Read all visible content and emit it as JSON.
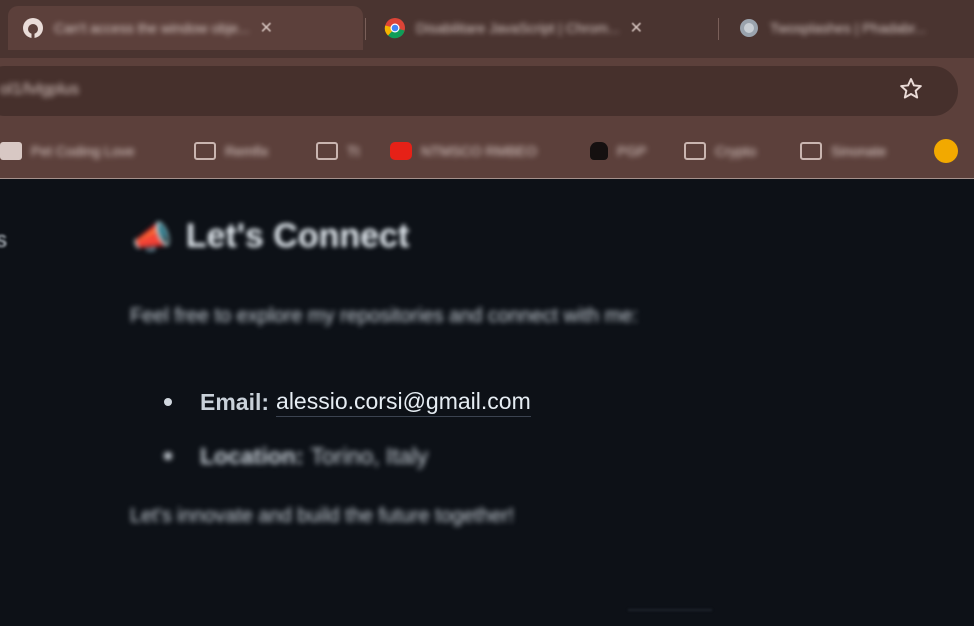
{
  "browser": {
    "tabs": [
      {
        "title": "Can't access the window obje...",
        "icon": "github-icon",
        "active": true
      },
      {
        "title": "Disabilitare JavaScript | Chrom...",
        "icon": "chrome-icon",
        "active": false
      },
      {
        "title": "Twosplashes | Phadabr...",
        "icon": "globe-icon",
        "active": false
      }
    ],
    "tab_close_glyph": "✕",
    "address": "ol1/lvlgplus",
    "bookmarks": [
      {
        "label": "Pet Coding Love",
        "icon": "image-icon"
      },
      {
        "label": "Remfix",
        "icon": "folder-icon"
      },
      {
        "label": "Tt",
        "icon": "folder-icon"
      },
      {
        "label": "NTMSCO RMBEO",
        "icon": "youtube-icon"
      },
      {
        "label": "PGP",
        "icon": "lock-icon"
      },
      {
        "label": "Crypto",
        "icon": "folder-icon"
      },
      {
        "label": "Sinonate",
        "icon": "folder-icon"
      }
    ],
    "colors": {
      "tabstrip": "#4a3430",
      "toolbar": "#5c403b",
      "omnibox": "#46302c"
    }
  },
  "page": {
    "side_fragment": "s",
    "heading": {
      "emoji": "📣",
      "text": "Let's Connect"
    },
    "intro": "Feel free to explore my repositories and connect with me:",
    "contacts": {
      "email_label": "Email:",
      "email_value": "alessio.corsi@gmail.com",
      "location_label": "Location:",
      "location_value": "Torino, Italy"
    },
    "outro": "Let's innovate and build the future together!",
    "colors": {
      "background": "#0d1117",
      "text": "#c9d1d9",
      "link": "#e6edf3"
    }
  }
}
